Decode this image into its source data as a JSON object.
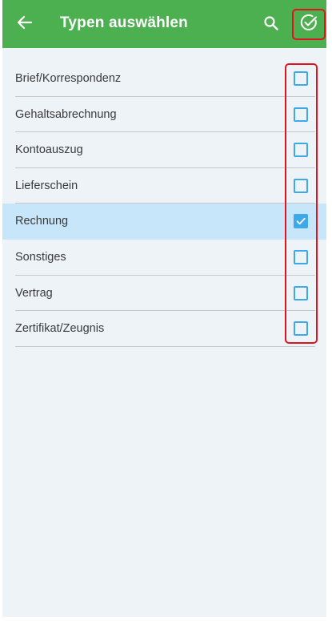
{
  "appbar": {
    "title": "Typen auswählen",
    "back_icon": "arrow-left-icon",
    "search_icon": "search-icon",
    "confirm_icon": "check-circle-icon",
    "color": "#4caf50"
  },
  "list": {
    "items": [
      {
        "label": "Brief/Korrespondenz",
        "checked": false
      },
      {
        "label": "Gehaltsabrechnung",
        "checked": false
      },
      {
        "label": "Kontoauszug",
        "checked": false
      },
      {
        "label": "Lieferschein",
        "checked": false
      },
      {
        "label": "Rechnung",
        "checked": true
      },
      {
        "label": "Sonstiges",
        "checked": false
      },
      {
        "label": "Vertrag",
        "checked": false
      },
      {
        "label": "Zertifikat/Zeugnis",
        "checked": false
      }
    ],
    "checkbox_color": "#3da9e8",
    "selected_row_color": "#c8e6f9"
  },
  "annotations": {
    "highlight_color": "#e0141e"
  }
}
